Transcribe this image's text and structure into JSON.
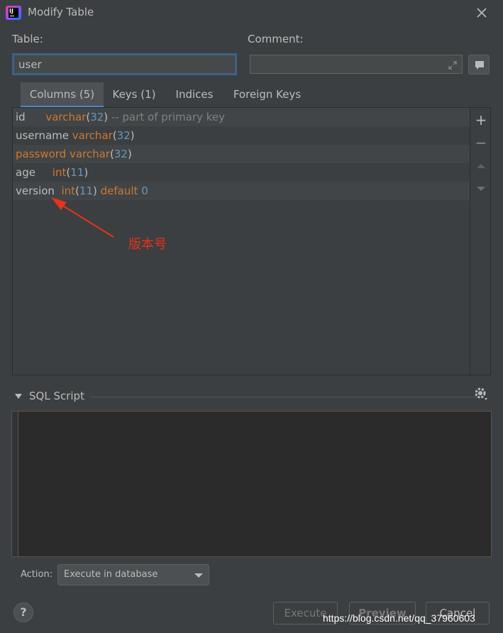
{
  "window": {
    "title": "Modify Table"
  },
  "form": {
    "table_label": "Table:",
    "table_value": "user",
    "comment_label": "Comment:",
    "comment_value": ""
  },
  "tabs": [
    {
      "label": "Columns (5)",
      "active": true
    },
    {
      "label": "Keys (1)",
      "active": false
    },
    {
      "label": "Indices",
      "active": false
    },
    {
      "label": "Foreign Keys",
      "active": false
    }
  ],
  "columns": [
    {
      "name": "id",
      "type": "varchar",
      "size": "32",
      "extra": "-- part of primary key"
    },
    {
      "name": "username",
      "type": "varchar",
      "size": "32"
    },
    {
      "name": "password",
      "type": "varchar",
      "size": "32"
    },
    {
      "name": "age",
      "type": "int",
      "size": "11"
    },
    {
      "name": "version",
      "type": "int",
      "size": "11",
      "default_kw": "default",
      "default_val": "0"
    }
  ],
  "annotation": {
    "text": "版本号",
    "color": "#e8321a"
  },
  "sql_script": {
    "title": "SQL Script",
    "content": ""
  },
  "action": {
    "label": "Action:",
    "selected": "Execute in database"
  },
  "buttons": {
    "execute": "Execute",
    "preview": "Preview",
    "cancel": "Cancel",
    "help": "?"
  },
  "watermark": "https://blog.csdn.net/qq_37960603",
  "colors": {
    "accent": "#4a88c7",
    "keyword": "#cc7832",
    "number": "#6897bb",
    "comment": "#808080"
  }
}
